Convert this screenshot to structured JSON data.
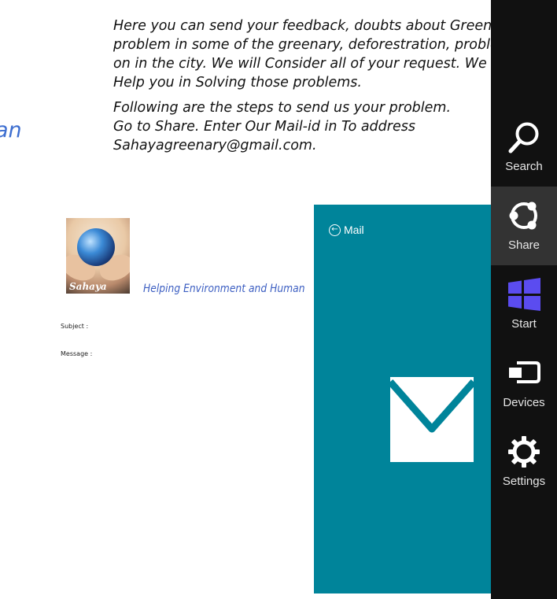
{
  "background_fragment": "an",
  "intro": {
    "line1": "Here you can send your feedback, doubts about Greenary or the",
    "line2": "problem in some of the greenary, deforestration, problem going",
    "line3": "on in the city. We will Consider all of your request. We will",
    "line4": "Help you in Solving those problems.",
    "line5": "Following are the steps to send us your problem.",
    "line6": "Go to Share. Enter Our Mail-id in To address",
    "line7": "Sahayagreenary@gmail.com."
  },
  "logo": {
    "word": "Sahaya"
  },
  "tagline": "Helping Environment and Human",
  "form": {
    "subject_label": "Subject :",
    "message_label": "Message :"
  },
  "mail_panel": {
    "back_label": "Mail",
    "color": "#00849a"
  },
  "charms": {
    "items": [
      {
        "label": "Search",
        "icon": "search-icon"
      },
      {
        "label": "Share",
        "icon": "share-icon"
      },
      {
        "label": "Start",
        "icon": "windows-start-icon"
      },
      {
        "label": "Devices",
        "icon": "devices-icon"
      },
      {
        "label": "Settings",
        "icon": "settings-icon"
      }
    ],
    "active": "Share",
    "start_color": "#5b4cf0"
  }
}
